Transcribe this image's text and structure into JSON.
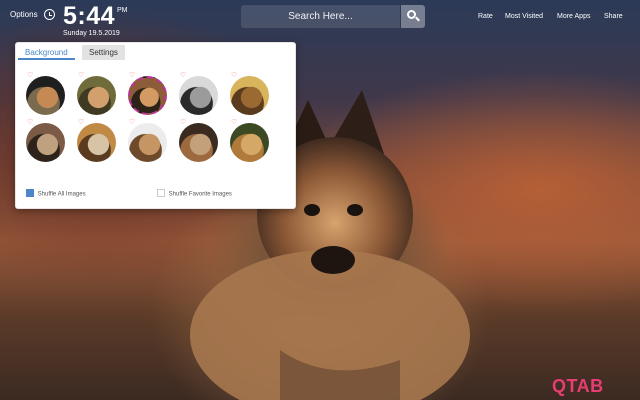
{
  "header": {
    "options_label": "Options",
    "time": "5:44",
    "ampm": "PM",
    "date": "Sunday  19.5.2019"
  },
  "search": {
    "placeholder": "Search Here..."
  },
  "top_links": {
    "rate": "Rate",
    "most_visited": "Most Visited",
    "more_apps": "More Apps",
    "share": "Share"
  },
  "panel": {
    "tabs": {
      "background": "Background",
      "settings": "Settings"
    },
    "thumbnails": [
      {
        "colors": [
          "#1f1f1f",
          "#7a6a4f",
          "#c58a53"
        ],
        "selected": false
      },
      {
        "colors": [
          "#6f6b3a",
          "#3f3a22",
          "#d2a06c"
        ],
        "selected": false
      },
      {
        "colors": [
          "#8c5d38",
          "#2c2218",
          "#d49a63"
        ],
        "selected": true
      },
      {
        "colors": [
          "#d9d9d9",
          "#2a2a2a",
          "#9b9b9b"
        ],
        "selected": false
      },
      {
        "colors": [
          "#d8b45d",
          "#5a3b1d",
          "#9a6a32"
        ],
        "selected": false
      },
      {
        "colors": [
          "#7b5a46",
          "#2d231b",
          "#bfa07f"
        ],
        "selected": false
      },
      {
        "colors": [
          "#c08a45",
          "#5b3b1f",
          "#d7c3a6"
        ],
        "selected": false
      },
      {
        "colors": [
          "#ececec",
          "#6e4a2a",
          "#c59563"
        ],
        "selected": false
      },
      {
        "colors": [
          "#3b2a20",
          "#9d6a3f",
          "#c4a07a"
        ],
        "selected": false
      },
      {
        "colors": [
          "#3b4a22",
          "#b07a3a",
          "#d5a866"
        ],
        "selected": false
      }
    ],
    "shuffle_all": "Shuffle All Images",
    "shuffle_favorite": "Shuffle Favorite Images"
  },
  "brand": "QTAB",
  "colors": {
    "accent": "#4a86c8",
    "brand": "#e83d74",
    "heart": "#e6796f"
  }
}
